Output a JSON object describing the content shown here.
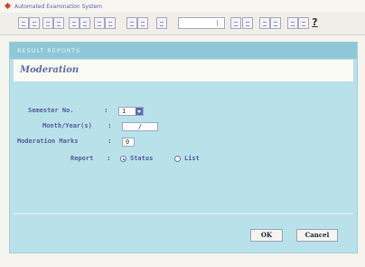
{
  "window": {
    "title": "Automated Examination System"
  },
  "toolbar": {
    "help_label": "?"
  },
  "panel": {
    "header": "RESULT REPORTS",
    "title": "Moderation"
  },
  "form": {
    "semester": {
      "label": "Semester No.",
      "value": "1"
    },
    "month_year": {
      "label": "Month/Year(s)",
      "value": "/"
    },
    "marks": {
      "label": "Moderation Marks",
      "value": "0"
    },
    "report": {
      "label": "Report",
      "options": [
        {
          "label": "Status",
          "checked": true
        },
        {
          "label": "List",
          "checked": false
        }
      ]
    }
  },
  "buttons": {
    "ok": "OK",
    "cancel": "Cancel"
  }
}
